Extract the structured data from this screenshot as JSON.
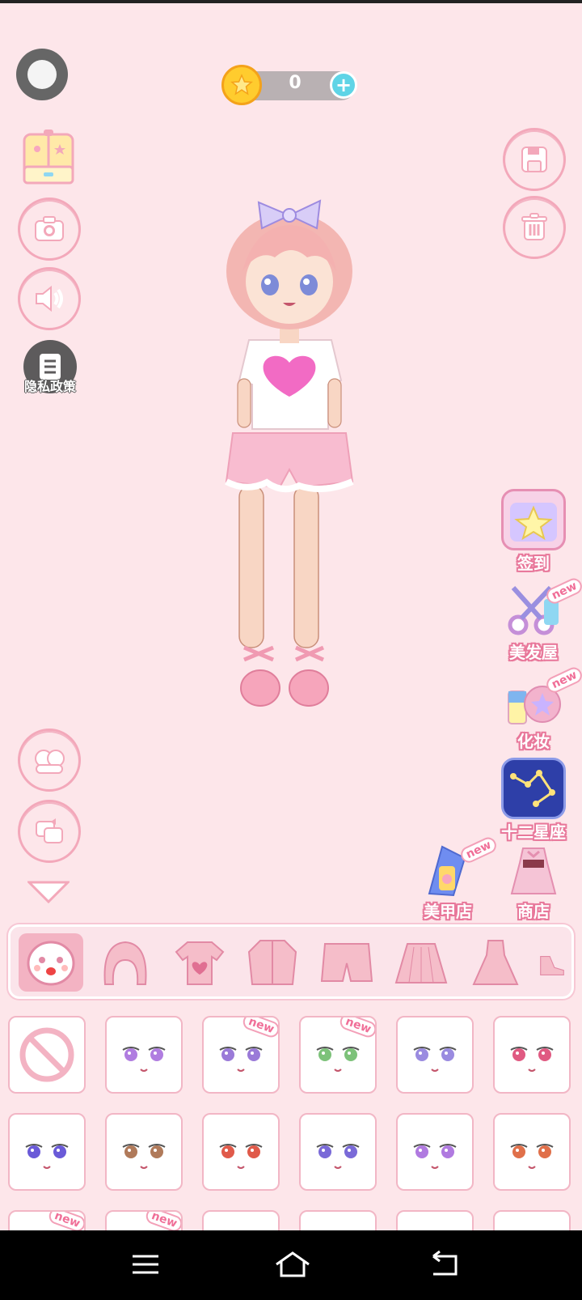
{
  "coins": {
    "value": "0"
  },
  "left_buttons": {
    "privacy_label": "隐私政策"
  },
  "right_features": [
    {
      "id": "checkin",
      "label": "签到",
      "new": false
    },
    {
      "id": "hair-salon",
      "label": "美发屋",
      "new": true
    },
    {
      "id": "makeup",
      "label": "化妆",
      "new": true
    },
    {
      "id": "zodiac",
      "label": "十二星座",
      "new": false
    }
  ],
  "bottom_features": [
    {
      "id": "nail-shop",
      "label": "美甲店",
      "new": true
    },
    {
      "id": "shop",
      "label": "商店",
      "new": false
    }
  ],
  "new_tag": "new",
  "categories": [
    "face",
    "hair",
    "top",
    "jacket",
    "shorts",
    "skirt",
    "dress",
    "shoes"
  ],
  "grid_new_flags": [
    false,
    false,
    true,
    true,
    false,
    false,
    false,
    false,
    false,
    false,
    false,
    false,
    true,
    true,
    false,
    false,
    false,
    false
  ],
  "colors": {
    "background": "#fde6ea",
    "accent": "#f3a8ba",
    "label": "#e8779a"
  }
}
